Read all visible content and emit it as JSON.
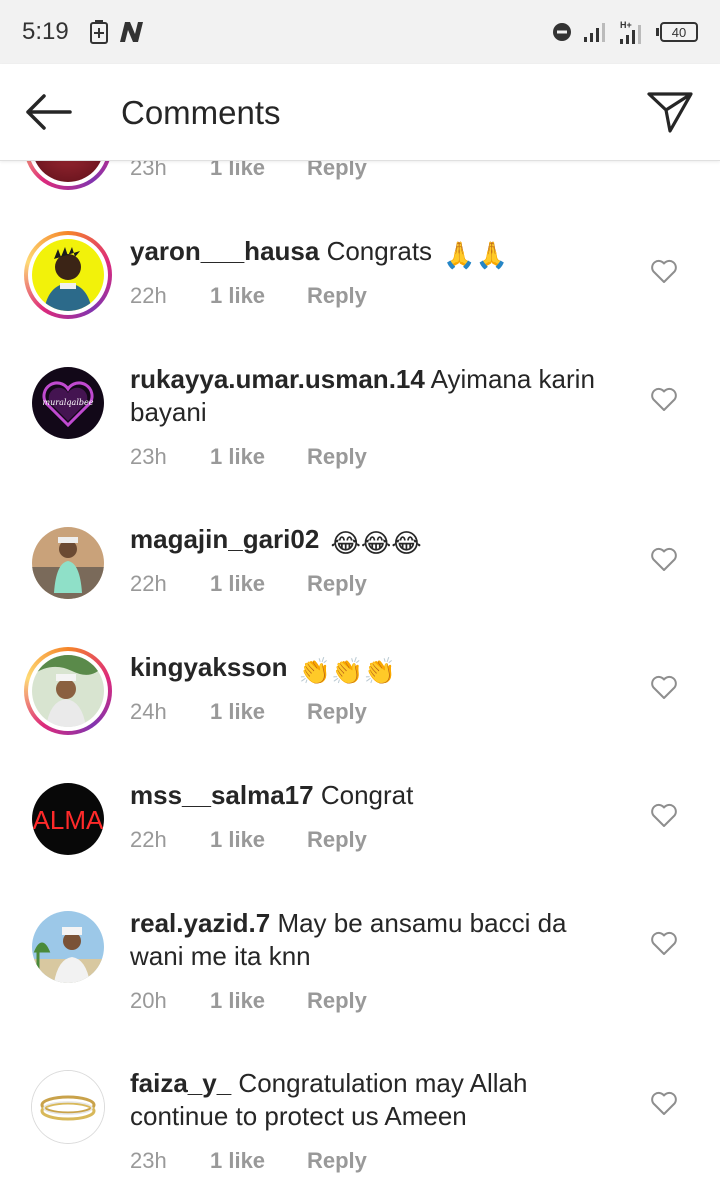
{
  "status_bar": {
    "time": "5:19",
    "battery": "40"
  },
  "header": {
    "title": "Comments"
  },
  "comments": [
    {
      "username": "",
      "text": "",
      "time": "23h",
      "likes": "1 like",
      "reply": "Reply"
    },
    {
      "username": "yaron___hausa",
      "text": "Congrats",
      "emoji": "🙏🙏",
      "time": "22h",
      "likes": "1 like",
      "reply": "Reply"
    },
    {
      "username": "rukayya.umar.usman.14",
      "text": "Ayimana karin bayani",
      "time": "23h",
      "likes": "1 like",
      "reply": "Reply"
    },
    {
      "username": "magajin_gari02",
      "text": "",
      "emoji": "😂😂😂",
      "time": "22h",
      "likes": "1 like",
      "reply": "Reply"
    },
    {
      "username": "kingyaksson",
      "text": "",
      "emoji": "👏👏👏",
      "time": "24h",
      "likes": "1 like",
      "reply": "Reply"
    },
    {
      "username": "mss__salma17",
      "text": "Congrat",
      "time": "22h",
      "likes": "1 like",
      "reply": "Reply"
    },
    {
      "username": "real.yazid.7",
      "text": "May be ansamu bacci da wani me ita knn",
      "time": "20h",
      "likes": "1 like",
      "reply": "Reply"
    },
    {
      "username": "faiza_y_",
      "text": "Congratulation may Allah continue to protect us Ameen",
      "time": "23h",
      "likes": "1 like",
      "reply": "Reply"
    }
  ],
  "avatar_labels": {
    "rukayya": "muralqalbee",
    "salma": "ALMA"
  },
  "colors": {
    "story_ring": "#dd2a7b",
    "meta_text": "#999999",
    "text": "#262626"
  }
}
